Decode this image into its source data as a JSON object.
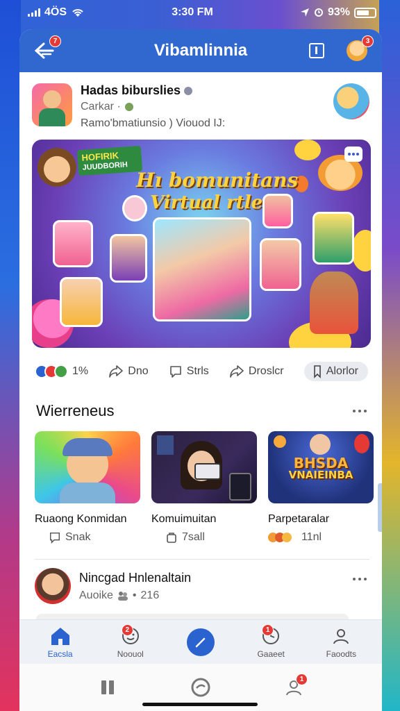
{
  "status": {
    "carrier": "4ÖS",
    "time": "3:30 FM",
    "battery": "93%"
  },
  "appbar": {
    "title": "Vibamlinnia",
    "back_badge": "7",
    "avatar_badge": "3"
  },
  "post": {
    "author": "Hadas biburslies",
    "sub": "Carkar ·",
    "desc": "Ramo'bmatiunsio ) Viouod IJ:",
    "banner": {
      "headline1": "Hı bomunitans",
      "headline2": "Virtual rtlenu",
      "tag_top": "HOFIRIK",
      "tag_bottom": "JUUDBORIH"
    },
    "actions": {
      "reactions_count": "1%",
      "share": "Dno",
      "comment": "Strls",
      "forward": "Droslcr",
      "save": "Alorlor"
    }
  },
  "section": {
    "title": "Wierreneus",
    "cards": [
      {
        "title": "Ruaong Konmidan",
        "meta": "Snak",
        "meta_icon": "comment-icon"
      },
      {
        "title": "Komuimuitan",
        "meta": "7sall",
        "meta_icon": "bag-icon"
      },
      {
        "title": "Parpetaralar",
        "meta": "11nl",
        "meta_icon": "reaction-icon",
        "thumb_text1": "BHSDA",
        "thumb_text2": "VNAIEINBA"
      }
    ]
  },
  "suggestion": {
    "name": "Nincgad Hnlenaltain",
    "meta": "Auoike",
    "meta_count": "216"
  },
  "tabs": [
    {
      "label": "Eacsla",
      "icon": "home-icon",
      "active": true
    },
    {
      "label": "Noouol",
      "icon": "smile-icon",
      "badge": "2"
    },
    {
      "label": "",
      "icon": "compose-icon"
    },
    {
      "label": "Gaaeet",
      "icon": "clock-icon",
      "badge": "1"
    },
    {
      "label": "Faoodts",
      "icon": "person-icon"
    }
  ],
  "navbar": {
    "profile_badge": "1"
  },
  "colors": {
    "brand": "#3168cf",
    "accent": "#2a62d0",
    "badge": "#e53935"
  }
}
